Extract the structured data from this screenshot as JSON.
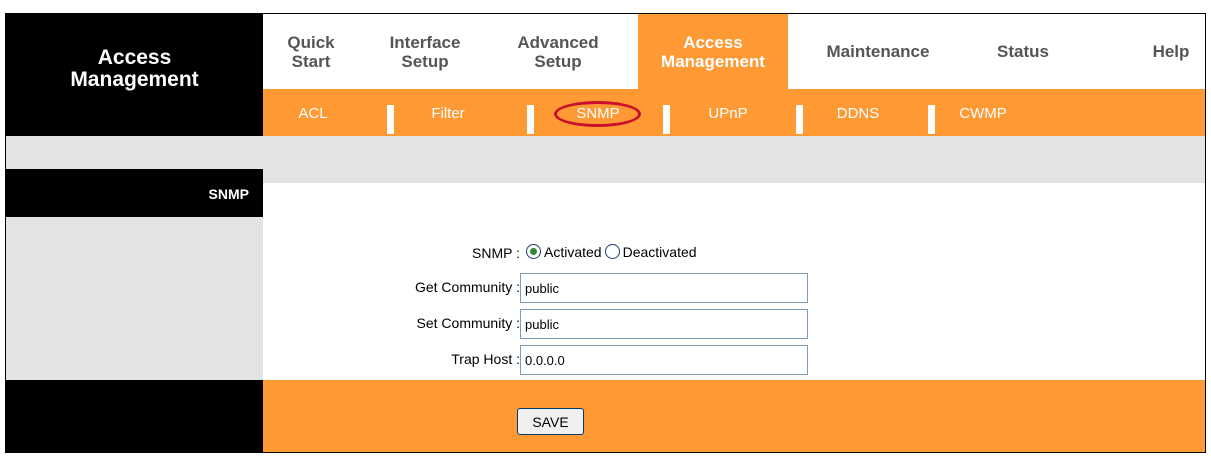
{
  "brand": {
    "title_line1": "Access",
    "title_line2": "Management"
  },
  "top_nav": [
    {
      "line1": "Quick",
      "line2": "Start"
    },
    {
      "line1": "Interface",
      "line2": "Setup"
    },
    {
      "line1": "Advanced",
      "line2": "Setup"
    },
    {
      "line1": "Access",
      "line2": "Management",
      "active": true
    },
    {
      "line1": "Maintenance",
      "line2": ""
    },
    {
      "line1": "Status",
      "line2": ""
    },
    {
      "line1": "Help",
      "line2": ""
    }
  ],
  "sub_nav": [
    "ACL",
    "Filter",
    "SNMP",
    "UPnP",
    "DDNS",
    "CWMP"
  ],
  "sub_nav_selected": "SNMP",
  "section": {
    "label": "SNMP"
  },
  "form": {
    "snmp_label": "SNMP :",
    "activated_label": "Activated",
    "deactivated_label": "Deactivated",
    "snmp_state": "Activated",
    "get_community_label": "Get Community :",
    "get_community_value": "public",
    "set_community_label": "Set Community :",
    "set_community_value": "public",
    "trap_host_label": "Trap Host :",
    "trap_host_value": "0.0.0.0"
  },
  "footer": {
    "save_label": "SAVE"
  },
  "colors": {
    "accent": "#ff9933",
    "highlight_ring": "#c8102e",
    "panel_gray": "#e3e3e3"
  }
}
